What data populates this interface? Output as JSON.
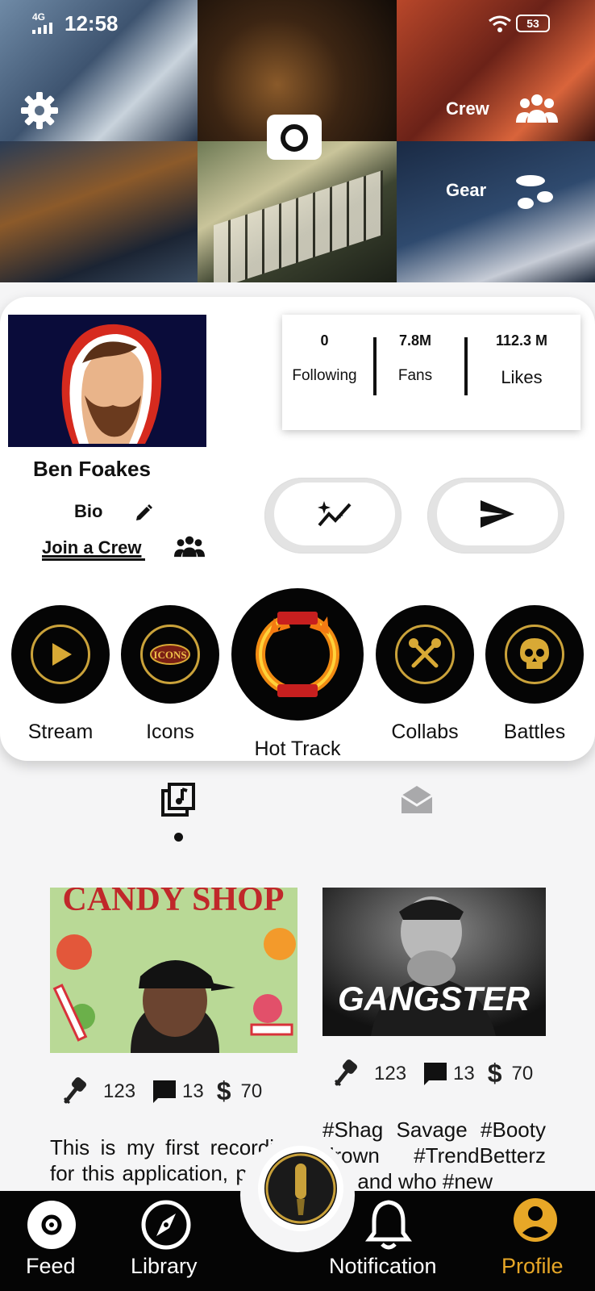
{
  "status_bar": {
    "network": "4G",
    "time": "12:58",
    "battery": "53"
  },
  "header": {
    "crew_label": "Crew",
    "gear_label": "Gear"
  },
  "profile": {
    "name": "Ben Foakes",
    "bio_label": "Bio",
    "join_crew_label": "Join a Crew",
    "stats": [
      {
        "value": "0",
        "label": "Following"
      },
      {
        "value": "7.8M",
        "label": "Fans"
      },
      {
        "value": "112.3 M",
        "label": "Likes"
      }
    ]
  },
  "categories": [
    {
      "label": "Stream",
      "icon": "play-icon"
    },
    {
      "label": "Icons",
      "icon": "icons-badge-icon"
    },
    {
      "label": "Hot Track",
      "icon": "hot-track-fire-ring-icon"
    },
    {
      "label": "Collabs",
      "icon": "crossed-mics-icon"
    },
    {
      "label": "Battles",
      "icon": "skull-icon"
    }
  ],
  "tabs": [
    {
      "name": "music-library-icon",
      "active": true
    },
    {
      "name": "inbox-icon",
      "active": false
    }
  ],
  "posts": [
    {
      "cover_text": "CANDY SHOP",
      "likes": "123",
      "comments": "13",
      "price": "70",
      "description": "This is my first recording for this application, please like and share for more"
    },
    {
      "cover_text": "GANGSTER",
      "likes": "123",
      "comments": "13",
      "price": "70",
      "description": "#Shag Savage #Booty drown #TrendBetterz me and who #new"
    }
  ],
  "currency_symbol": "$",
  "nav": {
    "items": [
      {
        "label": "Feed"
      },
      {
        "label": "Library"
      },
      {
        "label": "Notification"
      },
      {
        "label": "Profile"
      }
    ],
    "active_color": "#e7a727"
  }
}
